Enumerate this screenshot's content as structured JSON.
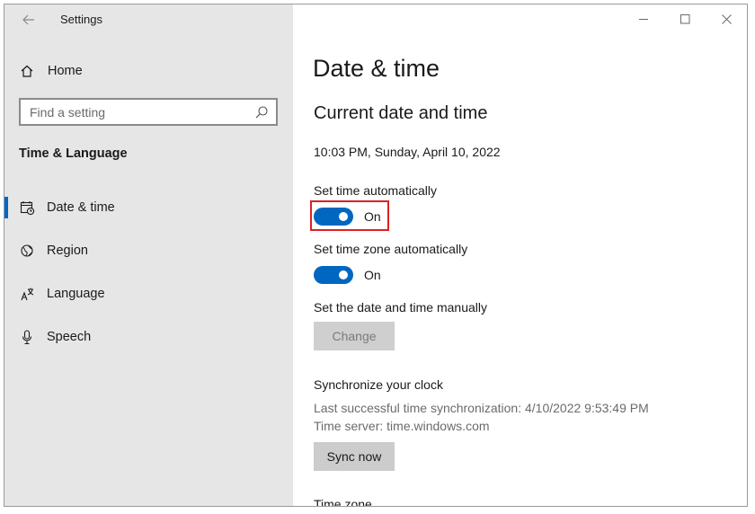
{
  "window": {
    "app_title": "Settings"
  },
  "sidebar": {
    "home_label": "Home",
    "search_placeholder": "Find a setting",
    "section_title": "Time & Language",
    "items": [
      {
        "label": "Date & time",
        "icon": "calendar-clock-icon",
        "selected": true
      },
      {
        "label": "Region",
        "icon": "globe-icon",
        "selected": false
      },
      {
        "label": "Language",
        "icon": "language-icon",
        "selected": false
      },
      {
        "label": "Speech",
        "icon": "microphone-icon",
        "selected": false
      }
    ]
  },
  "main": {
    "title": "Date & time",
    "subtitle": "Current date and time",
    "current_datetime": "10:03 PM, Sunday, April 10, 2022",
    "auto_time": {
      "label": "Set time automatically",
      "state": "On"
    },
    "auto_timezone": {
      "label": "Set time zone automatically",
      "state": "On"
    },
    "manual": {
      "label": "Set the date and time manually",
      "button": "Change"
    },
    "sync": {
      "heading": "Synchronize your clock",
      "last_sync": "Last successful time synchronization: 4/10/2022 9:53:49 PM",
      "server": "Time server: time.windows.com",
      "button": "Sync now"
    },
    "next_heading": "Time zone"
  },
  "colors": {
    "accent": "#0067c0",
    "highlight": "#e02020",
    "sidebar_bg": "#e6e6e6"
  }
}
